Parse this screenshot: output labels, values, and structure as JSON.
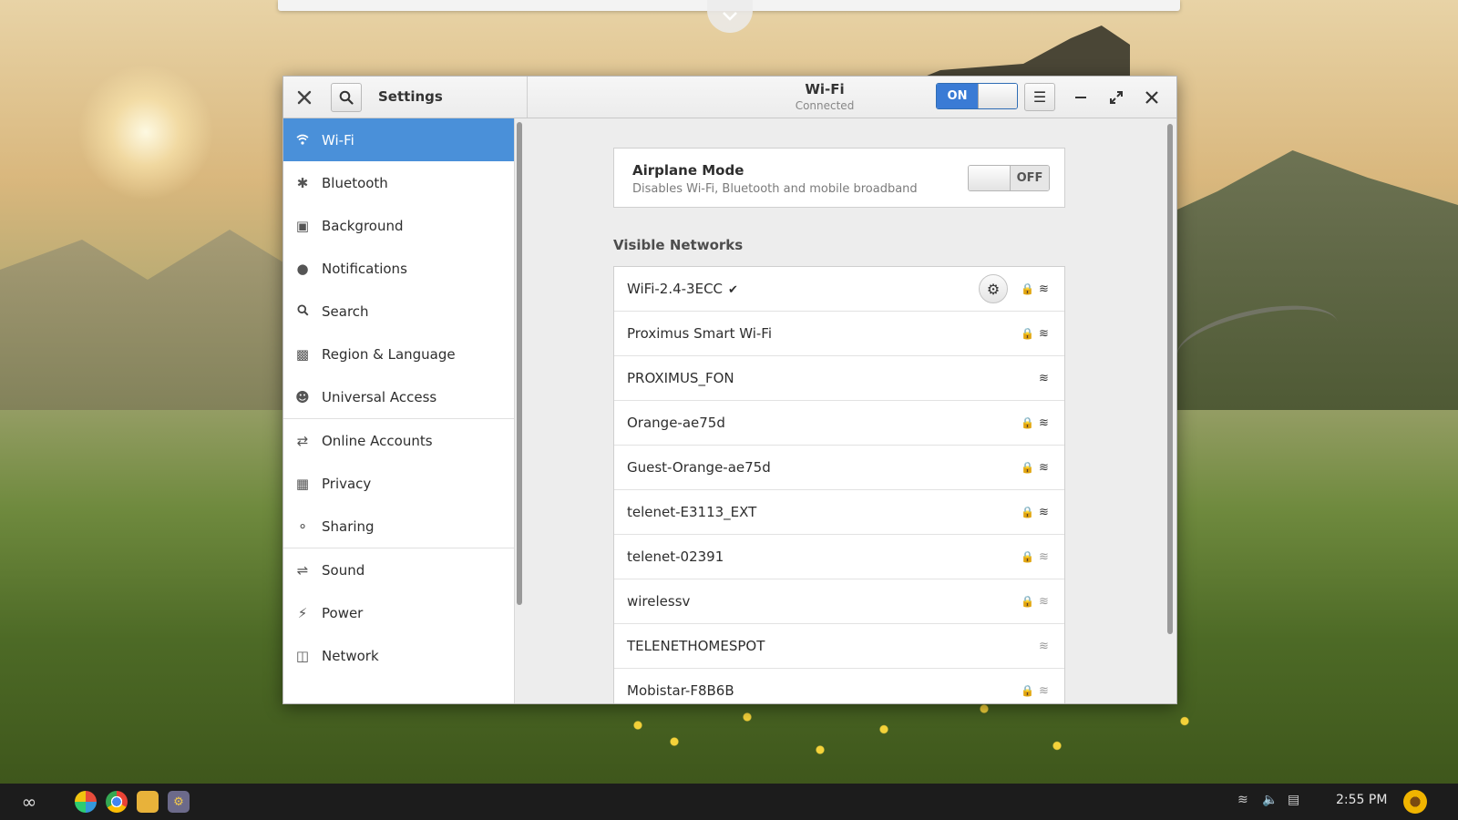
{
  "window": {
    "app_title": "Settings",
    "panel_title": "Wi-Fi",
    "panel_subtitle": "Connected",
    "wifi_switch_label": "ON",
    "wifi_enabled": true
  },
  "sidebar": {
    "items": [
      {
        "label": "Wi-Fi",
        "icon": "wifi-icon",
        "active": true
      },
      {
        "label": "Bluetooth",
        "icon": "bluetooth-icon"
      },
      {
        "label": "Background",
        "icon": "background-icon"
      },
      {
        "label": "Notifications",
        "icon": "notifications-icon"
      },
      {
        "label": "Search",
        "icon": "search-icon"
      },
      {
        "label": "Region & Language",
        "icon": "region-icon"
      },
      {
        "label": "Universal Access",
        "icon": "accessibility-icon"
      },
      {
        "label": "Online Accounts",
        "icon": "online-accounts-icon"
      },
      {
        "label": "Privacy",
        "icon": "privacy-icon"
      },
      {
        "label": "Sharing",
        "icon": "share-icon"
      },
      {
        "label": "Sound",
        "icon": "sound-icon"
      },
      {
        "label": "Power",
        "icon": "power-icon"
      },
      {
        "label": "Network",
        "icon": "network-icon"
      }
    ]
  },
  "airplane": {
    "title": "Airplane Mode",
    "description": "Disables Wi-Fi, Bluetooth and mobile broadband",
    "switch_label": "OFF",
    "enabled": false
  },
  "networks": {
    "section_label": "Visible Networks",
    "items": [
      {
        "name": "WiFi-2.4-3ECC",
        "connected": true,
        "secured": true,
        "signal": "strong"
      },
      {
        "name": "Proximus Smart Wi-Fi",
        "secured": true,
        "signal": "strong"
      },
      {
        "name": "PROXIMUS_FON",
        "secured": false,
        "signal": "strong"
      },
      {
        "name": "Orange-ae75d",
        "secured": true,
        "signal": "strong"
      },
      {
        "name": "Guest-Orange-ae75d",
        "secured": true,
        "signal": "medium"
      },
      {
        "name": "telenet-E3113_EXT",
        "secured": true,
        "signal": "medium"
      },
      {
        "name": "telenet-02391",
        "secured": true,
        "signal": "weak"
      },
      {
        "name": "wirelessv",
        "secured": true,
        "signal": "weak"
      },
      {
        "name": "TELENETHOMESPOT",
        "secured": false,
        "signal": "weak"
      },
      {
        "name": "Mobistar-F8B6B",
        "secured": true,
        "signal": "weak"
      }
    ]
  },
  "taskbar": {
    "clock": "2:55 PM"
  },
  "colors": {
    "accent": "#4a90d9",
    "switch_on": "#3a7bd5",
    "taskbar": "#1c1c1c"
  }
}
